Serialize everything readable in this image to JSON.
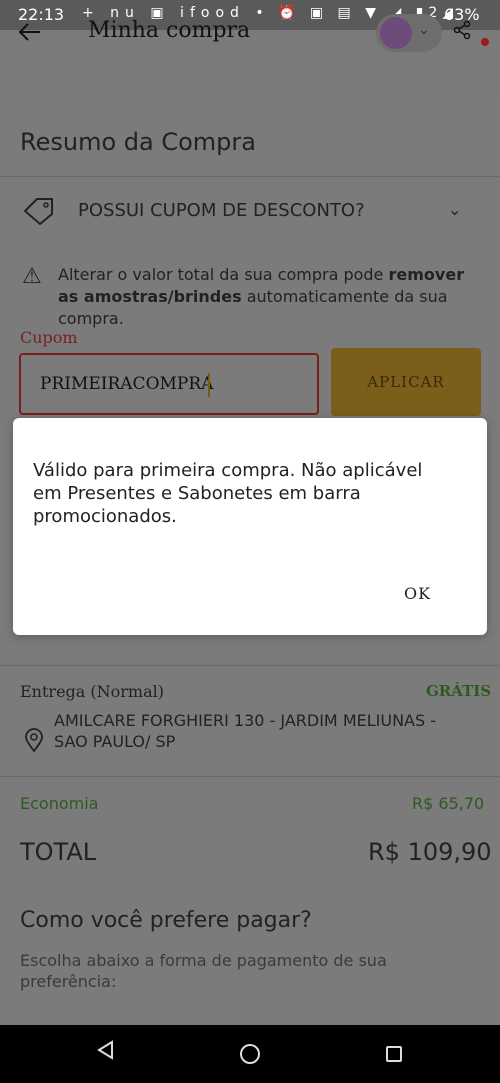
{
  "status_bar": {
    "time": "22:13",
    "left_icons": [
      "+",
      "nu",
      "▣",
      "ifood",
      "•"
    ],
    "right_icons": [
      "⏰",
      "▣",
      "📳",
      "▼",
      "◢",
      "VoLTE",
      "2◢"
    ],
    "battery": "63%"
  },
  "app_bar": {
    "title": "Minha compra",
    "back_icon": "arrow-left-icon",
    "share_icon": "share-icon"
  },
  "summary": {
    "title": "Resumo da Compra",
    "coupon_row_label": "POSSUI CUPOM DE DESCONTO?",
    "warning_text_1": "Alterar o valor total da sua compra pode ",
    "warning_bold": "remover as amostras/brindes",
    "warning_text_2": " automaticamente da sua compra.",
    "coupon_field_label": "Cupom",
    "coupon_value": "PRIMEIRACOMPRA",
    "apply_label": "APLICAR"
  },
  "delivery": {
    "label": "Entrega (Normal)",
    "price": "GRÁTIS",
    "address": "AMILCARE FORGHIERI 130 - JARDIM MELIUNAS - SAO PAULO/ SP"
  },
  "totals": {
    "economia_label": "Economia",
    "economia_value": "R$ 65,70",
    "total_label": "TOTAL",
    "total_value": "R$ 109,90"
  },
  "payment": {
    "title": "Como você prefere pagar?",
    "subtitle": "Escolha abaixo a forma de pagamento de sua preferência:"
  },
  "dialog": {
    "message": "Válido para primeira compra. Não aplicável em Presentes e Sabonetes em barra promocionados.",
    "ok_label": "OK"
  },
  "colors": {
    "accent_gold": "#e3a933",
    "error_red": "#b71c1c",
    "savings_green": "#558b2f"
  }
}
